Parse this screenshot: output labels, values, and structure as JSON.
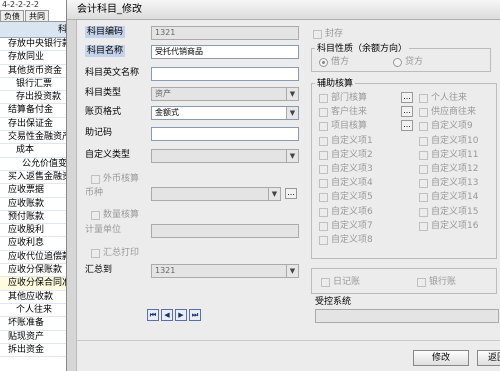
{
  "background": {
    "top_text": "4-2-2-2-2",
    "tabs": [
      "负债",
      "共同"
    ],
    "header": "科目",
    "rows": [
      {
        "label": "存放中央银行款",
        "indent": 0
      },
      {
        "label": "存放同业",
        "indent": 0
      },
      {
        "label": "其他货币资金",
        "indent": 0
      },
      {
        "label": "银行汇票",
        "indent": 1
      },
      {
        "label": "存出投资款",
        "indent": 1
      },
      {
        "label": "结算备付金",
        "indent": 0
      },
      {
        "label": "存出保证金",
        "indent": 0
      },
      {
        "label": "交易性金融资产",
        "indent": 0
      },
      {
        "label": "成本",
        "indent": 1
      },
      {
        "label": "公允价值变动",
        "indent": 2
      },
      {
        "label": "买入返售金融资",
        "indent": 0
      },
      {
        "label": "应收票据",
        "indent": 0
      },
      {
        "label": "应收账款",
        "indent": 0
      },
      {
        "label": "预付账款",
        "indent": 0
      },
      {
        "label": "应收股利",
        "indent": 0
      },
      {
        "label": "应收利息",
        "indent": 0
      },
      {
        "label": "应收代位追偿款",
        "indent": 0
      },
      {
        "label": "应收分保账款",
        "indent": 0
      },
      {
        "label": "应收分保合同准",
        "indent": 0
      },
      {
        "label": "其他应收款",
        "indent": 0
      },
      {
        "label": "个人往来",
        "indent": 1
      },
      {
        "label": "坏账准备",
        "indent": 0
      },
      {
        "label": "贴现资产",
        "indent": 0
      },
      {
        "label": "拆出资金",
        "indent": 0
      }
    ]
  },
  "dialog": {
    "title": "会计科目_修改",
    "fields": {
      "code_label": "科目编码",
      "code_value": "1321",
      "name_label": "科目名称",
      "name_value": "受托代销商品",
      "en_name_label": "科目英文名称",
      "en_name_value": "",
      "type_label": "科目类型",
      "type_value": "资产",
      "format_label": "账页格式",
      "format_value": "金额式",
      "mnemonic_label": "助记码",
      "mnemonic_value": "",
      "custom_type_label": "自定义类型",
      "custom_type_value": "",
      "foreign_label": "外币核算",
      "currency_label": "币种",
      "currency_value": "",
      "qty_label": "数量核算",
      "unit_label": "计量单位",
      "unit_value": "",
      "summary_print_label": "汇总打印",
      "summary_to_label": "汇总到",
      "summary_to_value": "1321"
    },
    "right": {
      "sealed_label": "封存",
      "nature_group_label": "科目性质（余额方向）",
      "debit_label": "借方",
      "credit_label": "贷方",
      "aux_group_label": "辅助核算",
      "aux_left": [
        "部门核算",
        "客户往来",
        "项目核算",
        "自定义项1",
        "自定义项2",
        "自定义项3",
        "自定义项4",
        "自定义项5",
        "自定义项6",
        "自定义项7",
        "自定义项8"
      ],
      "aux_right": [
        "个人往来",
        "供应商往来",
        "自定义项9",
        "自定义项10",
        "自定义项11",
        "自定义项12",
        "自定义项13",
        "自定义项14",
        "自定义项15",
        "自定义项16"
      ],
      "journal_label": "日记账",
      "bank_journal_label": "银行账",
      "controlled_label": "受控系统"
    },
    "nav": [
      "⏮",
      "◀",
      "▶",
      "⏭"
    ],
    "buttons": {
      "modify": "修改",
      "back": "返回"
    }
  }
}
